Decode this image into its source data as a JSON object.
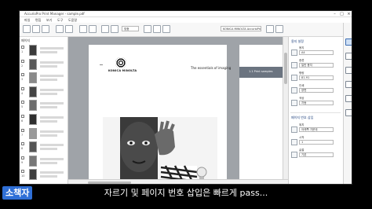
{
  "window": {
    "title": "AccurioPro Print Manager - sample.pdf",
    "minimize": "–",
    "maximize": "□",
    "close": "×"
  },
  "menu": [
    "파일",
    "편집",
    "보기",
    "도구",
    "도움말"
  ],
  "toolbar": {
    "zoom": "맞춤",
    "file_name": "KONICA MINOLTA AccurioPress"
  },
  "left_panel": {
    "header": "페이지",
    "pages": [
      {
        "num": "1"
      },
      {
        "num": "2"
      },
      {
        "num": "3"
      },
      {
        "num": "4"
      },
      {
        "num": "5"
      },
      {
        "num": "6"
      },
      {
        "num": "7"
      },
      {
        "num": "8"
      },
      {
        "num": "9"
      },
      {
        "num": "10"
      }
    ]
  },
  "document": {
    "brand": "KONICA MINOLTA",
    "tagline": "The essentials of imaging",
    "next_page_band": "1.1 Print samples"
  },
  "right_panel": {
    "title": "용지 설정",
    "rows": [
      {
        "label": "용지",
        "value": "A4"
      },
      {
        "label": "종류",
        "value": "일반 용지"
      },
      {
        "label": "평량",
        "value": "81-91"
      },
      {
        "label": "인쇄",
        "value": "양면"
      },
      {
        "label": "색상",
        "value": "자동"
      }
    ],
    "section_title": "페이지 번호 삽입",
    "rows2": [
      {
        "label": "위치",
        "value": "아래쪽 가운데"
      },
      {
        "label": "시작",
        "value": "1"
      },
      {
        "label": "글꼴",
        "value": "기본"
      }
    ]
  },
  "overlay": {
    "channel": "소책자",
    "subtitle": "자르기 및 페이지 번호 삽입은 빠르게 pass..."
  },
  "colors": {
    "accent": "#2f6fd6",
    "canvas": "#9fa3a8",
    "band": "#6b7480"
  }
}
